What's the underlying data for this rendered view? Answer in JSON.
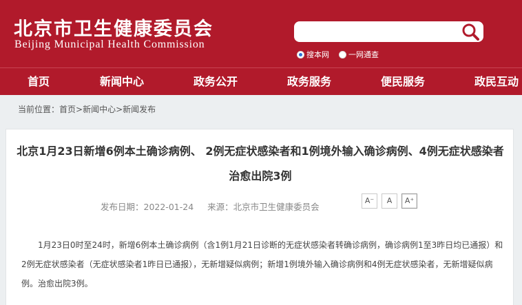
{
  "header": {
    "logo_cn": "北京市卫生健康委员会",
    "logo_en": "Beijing Municipal Health Commission",
    "search": {
      "value": "",
      "placeholder": ""
    },
    "search_icon": "search-icon",
    "radio_options": [
      {
        "label": "搜本网",
        "checked": true
      },
      {
        "label": "一网通查",
        "checked": false
      }
    ]
  },
  "nav": {
    "items": [
      {
        "label": "首页"
      },
      {
        "label": "新闻中心"
      },
      {
        "label": "政务公开"
      },
      {
        "label": "政务服务"
      },
      {
        "label": "便民服务"
      },
      {
        "label": "政民互动"
      }
    ]
  },
  "breadcrumb": {
    "prefix": "当前位置：",
    "items": [
      "首页",
      "新闻中心",
      "新闻发布"
    ],
    "separator": ">"
  },
  "article": {
    "title": "北京1月23日新增6例本土确诊病例、 2例无症状感染者和1例境外输入确诊病例、4例无症状感染者 治愈出院3例",
    "date": "发布日期：2022-01-24",
    "source": "来源：北京市卫生健康委员会",
    "font_buttons": [
      {
        "label": "A-",
        "display": "A⁻"
      },
      {
        "label": "A",
        "display": "A"
      },
      {
        "label": "A+",
        "display": "A⁺"
      }
    ],
    "body": "1月23日0时至24时，新增6例本土确诊病例（含1例1月21日诊断的无症状感染者转确诊病例，确诊病例1至3昨日均已通报）和2例无症状感染者（无症状感染者1昨日已通报），无新增疑似病例；新增1例境外输入确诊病例和4例无症状感染者，无新增疑似病例。治愈出院3例。"
  },
  "colors": {
    "brand_red": "#b11a2b",
    "page_bg": "#eceff1",
    "text": "#333333"
  }
}
